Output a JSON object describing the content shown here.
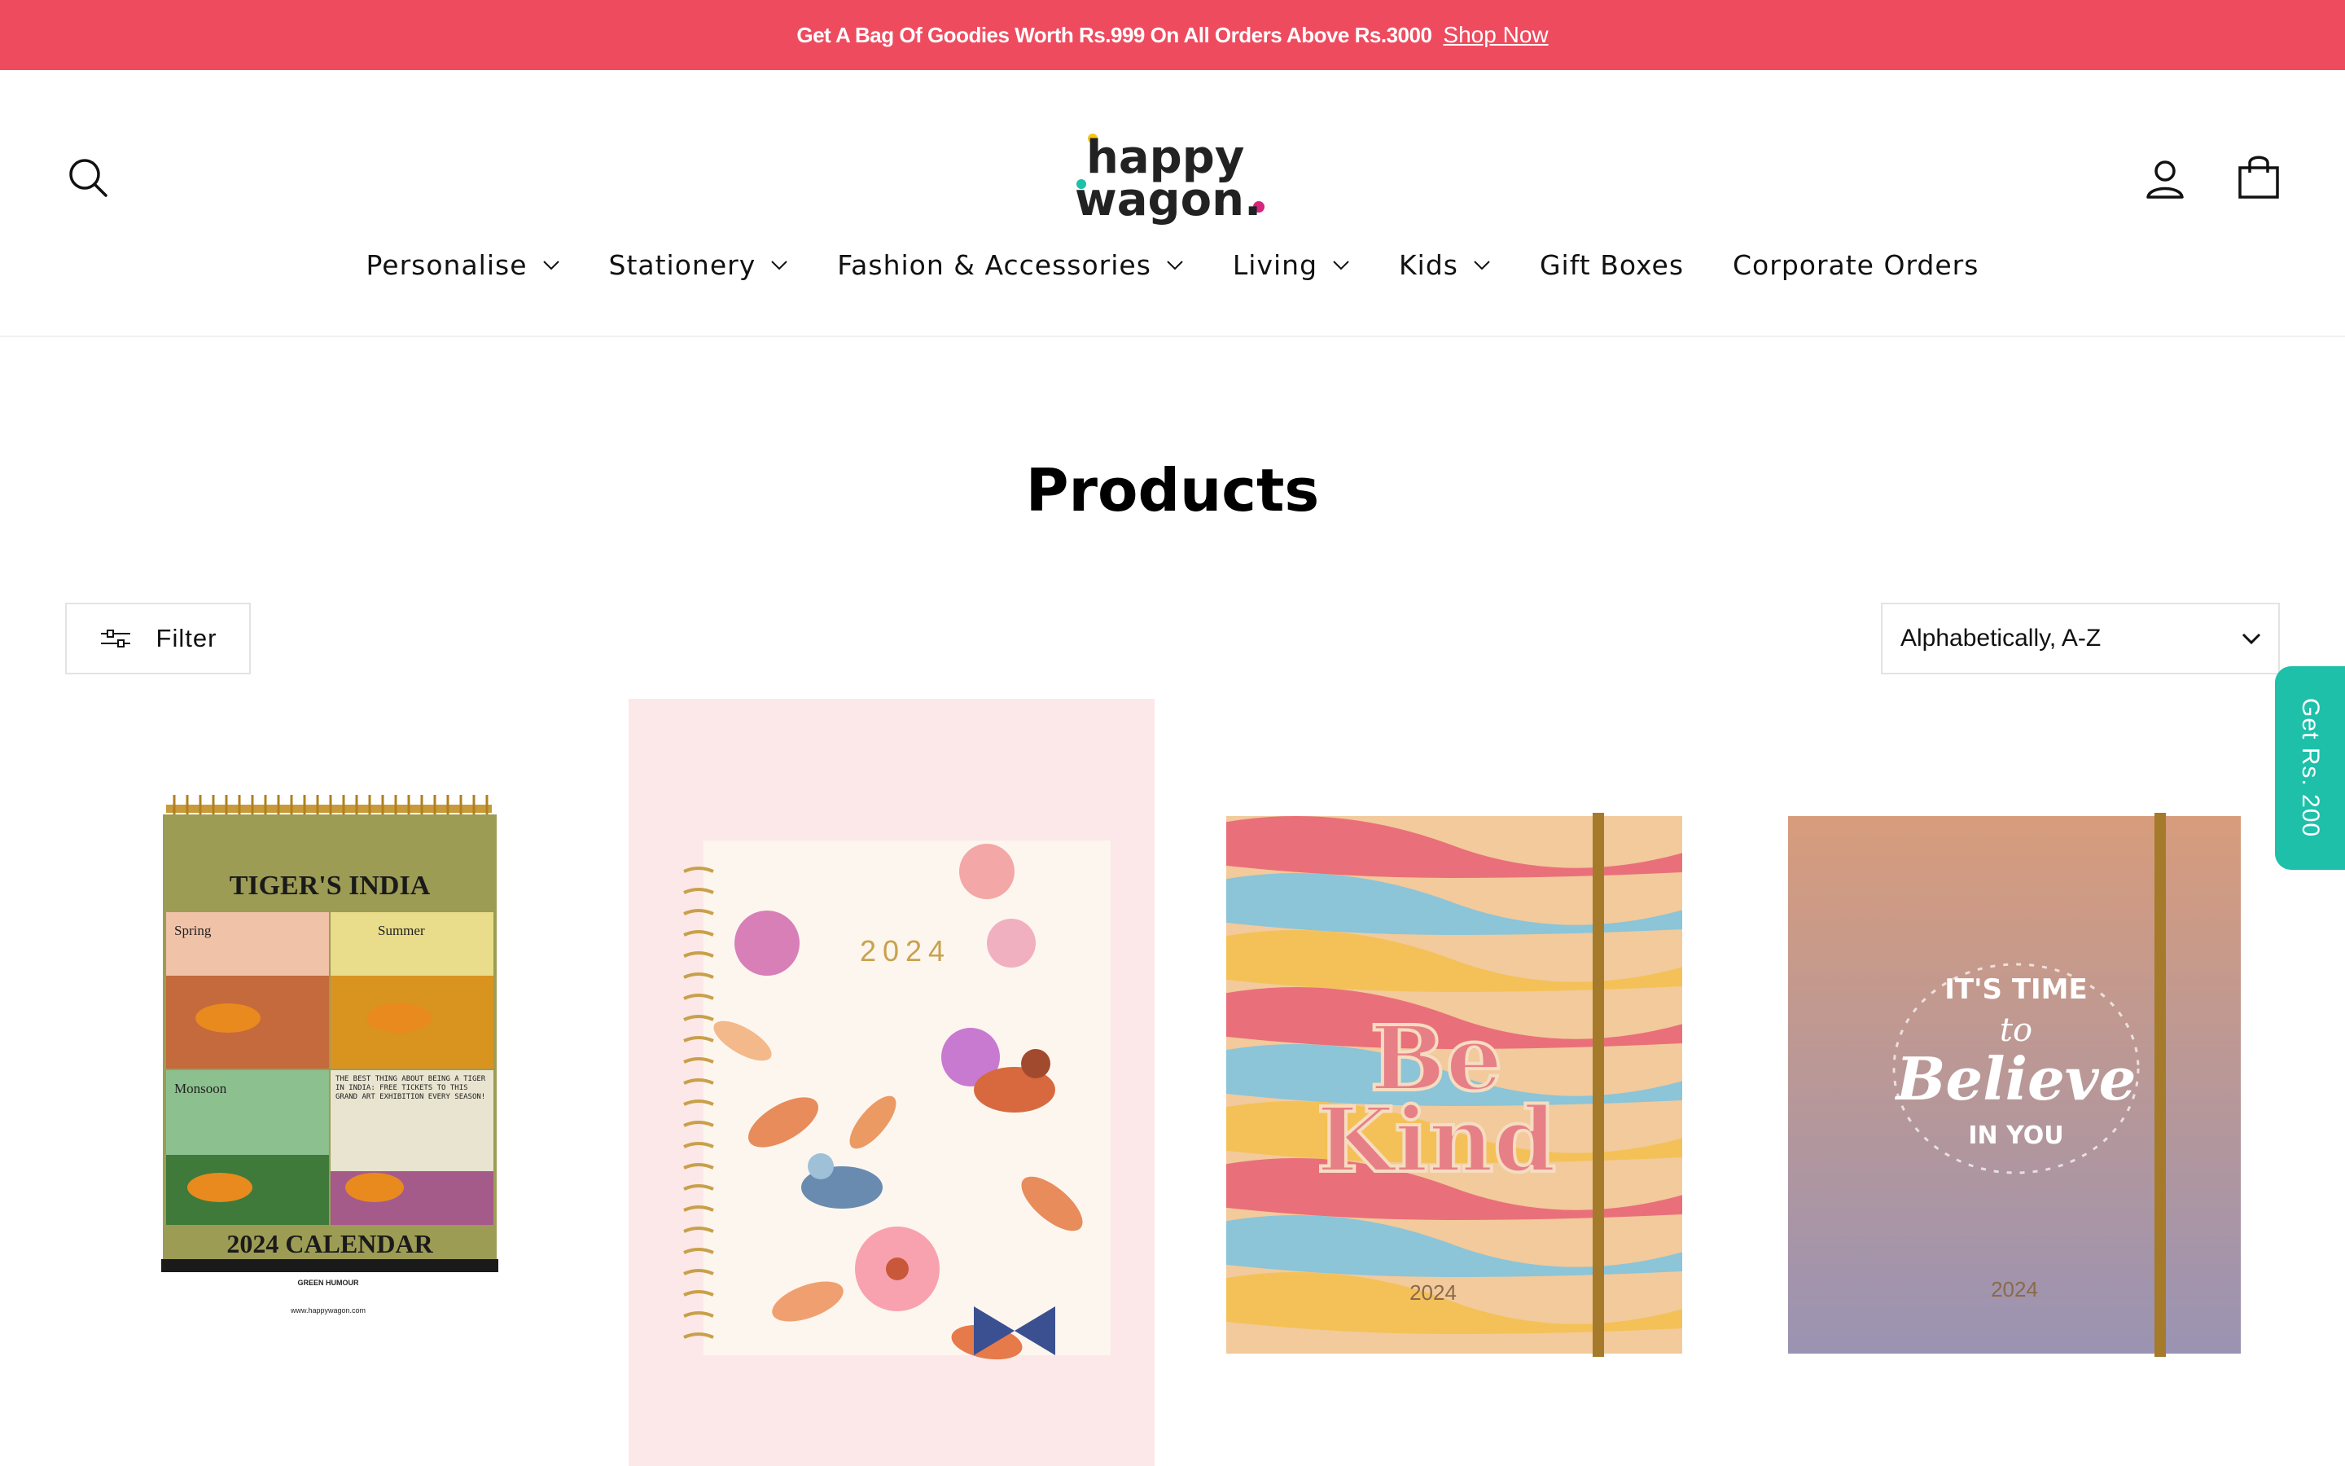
{
  "announcement": {
    "message": "Get A Bag Of Goodies Worth Rs.999 On All Orders Above Rs.3000",
    "link": "Shop Now"
  },
  "brand": {
    "name_line1": "happy",
    "name_line2": "wagon."
  },
  "header": {
    "icons": {
      "search": "search-icon",
      "account": "account-icon",
      "cart": "cart-icon"
    }
  },
  "nav": [
    {
      "label": "Personalise",
      "dropdown": true
    },
    {
      "label": "Stationery",
      "dropdown": true
    },
    {
      "label": "Fashion & Accessories",
      "dropdown": true
    },
    {
      "label": "Living",
      "dropdown": true
    },
    {
      "label": "Kids",
      "dropdown": true
    },
    {
      "label": "Gift Boxes",
      "dropdown": false
    },
    {
      "label": "Corporate Orders",
      "dropdown": false
    }
  ],
  "page": {
    "title": "Products"
  },
  "toolbar": {
    "filter_label": "Filter",
    "sort_selected": "Alphabetically, A-Z"
  },
  "side_tab": {
    "label": "Get Rs. 200"
  },
  "products": [
    {
      "cover_title": "TIGER'S INDIA",
      "panels": [
        "Spring",
        "Summer",
        "Monsoon"
      ],
      "panel_caption": "The best thing about being a tiger in India: Free tickets to this grand art exhibition every season!",
      "cover_subtitle": "2024 CALENDAR",
      "cover_credit": "GREEN HUMOUR",
      "cover_url": "www.happywagon.com"
    },
    {
      "cover_year": "2024"
    },
    {
      "cover_text_line1": "Be",
      "cover_text_line2": "Kind",
      "cover_year": "2024"
    },
    {
      "cover_text_line1": "IT'S TIME",
      "cover_text_line2": "to",
      "cover_text_line3": "Believe",
      "cover_text_line4": "IN YOU",
      "cover_year": "2024"
    }
  ],
  "colors": {
    "announcement_bg": "#ee4b5f",
    "side_tab_bg": "#1ec0a9",
    "product2_bg": "#fce8e8"
  }
}
